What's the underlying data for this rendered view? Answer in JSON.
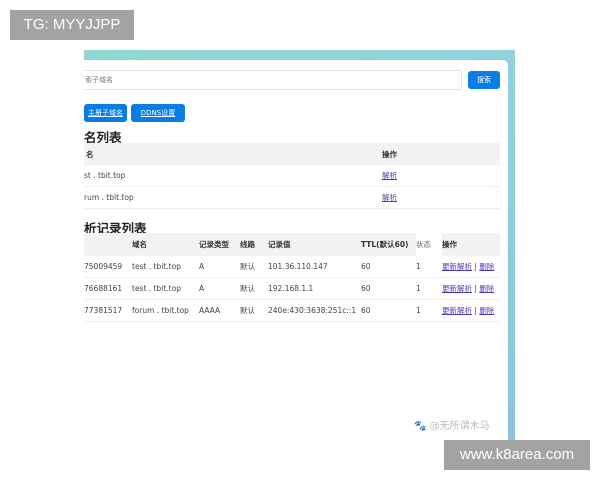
{
  "overlay": {
    "tg_label": "TG: MYYJJPP",
    "site_label": "www.k8area.com",
    "watermark": "🐾 @无所谓木马"
  },
  "search": {
    "placeholder": "索子域名",
    "button": "搜索"
  },
  "actions": {
    "register": "主册子域名",
    "ddns": "DDNS设置"
  },
  "domain_list": {
    "title": "名列表",
    "headers": [
      "名",
      "操作"
    ],
    "rows": [
      {
        "domain": "st . tbit.top",
        "action": "解析"
      },
      {
        "domain": "rum . tbit.top",
        "action": "解析"
      }
    ]
  },
  "records": {
    "title": "析记录列表",
    "headers": [
      "",
      "域名",
      "记录类型",
      "线路",
      "记录值",
      "TTL(默认60)",
      "状态",
      "操作"
    ],
    "rows": [
      {
        "id": "75009459",
        "domain": "test . tbit.top",
        "type": "A",
        "line": "默认",
        "value": "101.36.110.147",
        "ttl": "60",
        "status": "1",
        "update": "更新解析",
        "sep": "|",
        "delete": "删除"
      },
      {
        "id": "76688161",
        "domain": "test . tbit.top",
        "type": "A",
        "line": "默认",
        "value": "192.168.1.1",
        "ttl": "60",
        "status": "1",
        "update": "更新解析",
        "sep": "|",
        "delete": "删除"
      },
      {
        "id": "77381517",
        "domain": "forum . tbit.top",
        "type": "AAAA",
        "line": "默认",
        "value": "240e:430:3638:251c::1",
        "ttl": "60",
        "status": "1",
        "update": "更新解析",
        "sep": "|",
        "delete": "删除"
      }
    ]
  },
  "colors": {
    "primary": "#0a7ce6",
    "frame": "#8fd8d2"
  }
}
